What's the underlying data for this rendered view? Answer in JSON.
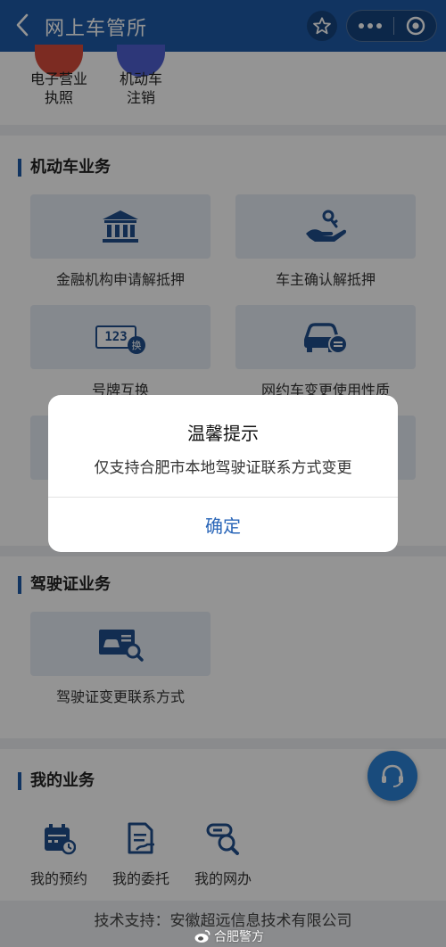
{
  "header": {
    "title": "网上车管所",
    "back_icon": "chevron-left-icon",
    "star_icon": "star-icon",
    "more_icon": "more-icon",
    "close_icon": "target-icon",
    "bg_color": "#1e5ba8"
  },
  "top_items": [
    {
      "label_line1": "电子营业",
      "label_line2": "执照",
      "color": "#d64b3b"
    },
    {
      "label_line1": "机动车",
      "label_line2": "注销",
      "color": "#4f5fd0"
    }
  ],
  "vehicle_section": {
    "title": "机动车业务",
    "items": [
      {
        "label": "金融机构申请解抵押",
        "icon": "bank-icon"
      },
      {
        "label": "车主确认解抵押",
        "icon": "hand-key-icon"
      },
      {
        "label": "号牌互换",
        "icon": "plate-swap-icon",
        "plate_text": "123",
        "swap_text": "换"
      },
      {
        "label": "网约车变更使用性质",
        "icon": "car-edit-icon"
      }
    ]
  },
  "license_section": {
    "title": "驾驶证业务",
    "items": [
      {
        "label": "驾驶证变更联系方式",
        "icon": "license-search-icon"
      }
    ]
  },
  "my_section": {
    "title": "我的业务",
    "items": [
      {
        "label": "我的预约",
        "icon": "calendar-icon"
      },
      {
        "label": "我的委托",
        "icon": "document-edit-icon"
      },
      {
        "label": "我的网办",
        "icon": "search-device-icon"
      }
    ]
  },
  "fab": {
    "icon": "headset-icon"
  },
  "footer": {
    "text": "技术支持：安徽超远信息技术有限公司"
  },
  "watermark": {
    "text": "合肥警方",
    "icon": "weibo-icon"
  },
  "dialog": {
    "title": "温馨提示",
    "message": "仅支持合肥市本地驾驶证联系方式变更",
    "confirm_label": "确定"
  },
  "colors": {
    "accent": "#1e5ba8",
    "icon_blue": "#1f4e8c",
    "link_blue": "#2a66b8"
  }
}
